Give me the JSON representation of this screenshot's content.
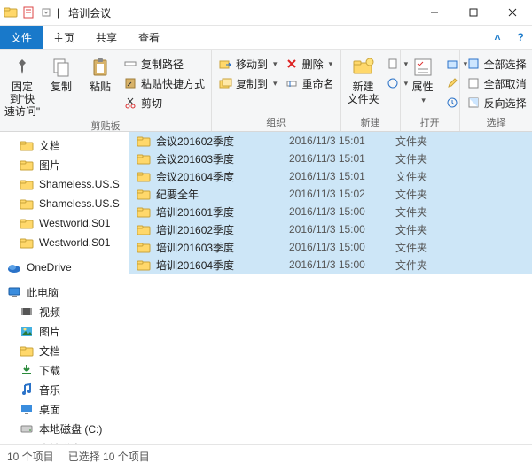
{
  "window": {
    "title": "培训会议",
    "sep": " | "
  },
  "menu": {
    "file": "文件",
    "home": "主页",
    "share": "共享",
    "view": "查看"
  },
  "ribbon": {
    "pin": "固定到\"快\n速访问\"",
    "copy": "复制",
    "paste": "粘贴",
    "copy_path": "复制路径",
    "paste_shortcut": "粘贴快捷方式",
    "cut": "剪切",
    "group_clipboard": "剪贴板",
    "move_to": "移动到",
    "copy_to": "复制到",
    "delete": "删除",
    "rename": "重命名",
    "group_organize": "组织",
    "new_folder": "新建\n文件夹",
    "group_new": "新建",
    "properties": "属性",
    "group_open": "打开",
    "select_all": "全部选择",
    "select_none": "全部取消",
    "invert": "反向选择",
    "group_select": "选择"
  },
  "tree": {
    "items": [
      {
        "icon": "folder",
        "label": "文档"
      },
      {
        "icon": "folder",
        "label": "图片"
      },
      {
        "icon": "folder",
        "label": "Shameless.US.S"
      },
      {
        "icon": "folder",
        "label": "Shameless.US.S"
      },
      {
        "icon": "folder",
        "label": "Westworld.S01"
      },
      {
        "icon": "folder",
        "label": "Westworld.S01"
      }
    ],
    "onedrive": "OneDrive",
    "thispc": "此电脑",
    "pc_items": [
      {
        "icon": "video",
        "label": "视频"
      },
      {
        "icon": "picture",
        "label": "图片"
      },
      {
        "icon": "folder",
        "label": "文档"
      },
      {
        "icon": "download",
        "label": "下载"
      },
      {
        "icon": "music",
        "label": "音乐"
      },
      {
        "icon": "desktop",
        "label": "桌面"
      },
      {
        "icon": "disk",
        "label": "本地磁盘 (C:)"
      },
      {
        "icon": "disk",
        "label": "本地磁盘 (D:)"
      }
    ]
  },
  "files": [
    {
      "name": "会议201602季度",
      "date": "2016/11/3 15:01",
      "type": "文件夹"
    },
    {
      "name": "会议201603季度",
      "date": "2016/11/3 15:01",
      "type": "文件夹"
    },
    {
      "name": "会议201604季度",
      "date": "2016/11/3 15:01",
      "type": "文件夹"
    },
    {
      "name": "纪要全年",
      "date": "2016/11/3 15:02",
      "type": "文件夹"
    },
    {
      "name": "培训201601季度",
      "date": "2016/11/3 15:00",
      "type": "文件夹"
    },
    {
      "name": "培训201602季度",
      "date": "2016/11/3 15:00",
      "type": "文件夹"
    },
    {
      "name": "培训201603季度",
      "date": "2016/11/3 15:00",
      "type": "文件夹"
    },
    {
      "name": "培训201604季度",
      "date": "2016/11/3 15:00",
      "type": "文件夹"
    }
  ],
  "status": {
    "count": "10 个项目",
    "selected": "已选择 10 个项目"
  }
}
